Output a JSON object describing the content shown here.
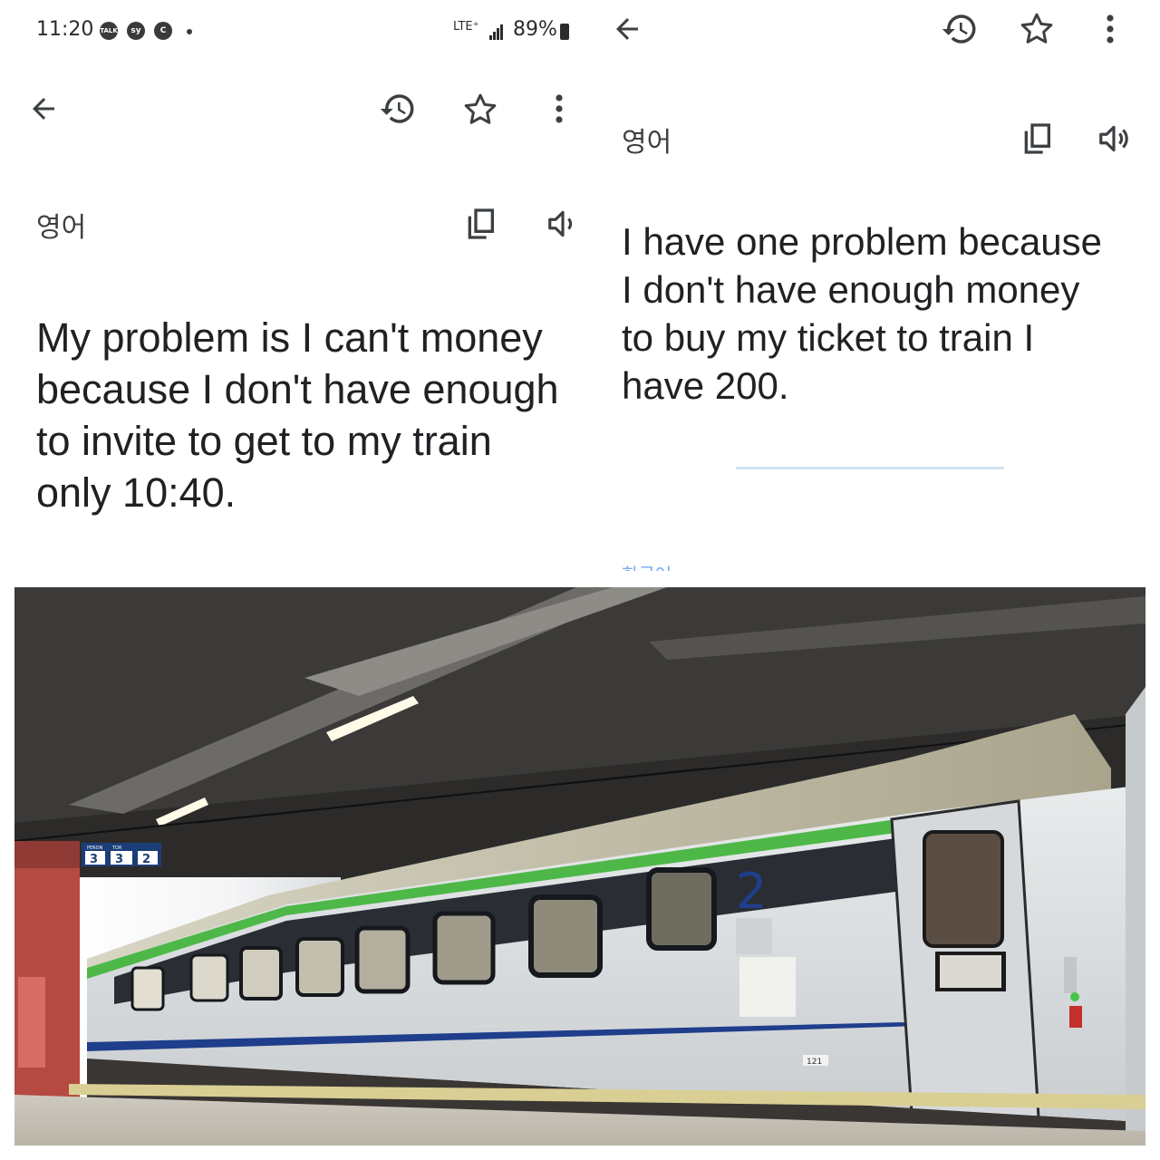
{
  "status_bar": {
    "time": "11:20",
    "badges": [
      "TALK",
      "sy",
      "C"
    ],
    "network": "LTE⁺",
    "battery": "89%"
  },
  "left_screen": {
    "language": "영어",
    "text_lines": [
      "My problem is I can't money",
      "because I don't have enough",
      "to invite to get to my train",
      "only 10:40."
    ],
    "icons": [
      "back-arrow-icon",
      "history-icon",
      "star-icon",
      "more-vert-icon",
      "copy-icon",
      "speaker-icon"
    ]
  },
  "right_screen": {
    "language": "영어",
    "text_lines": [
      "I have one problem because",
      "I don't have enough money",
      "to buy my ticket to train I",
      "have 200."
    ],
    "partial_label": "한국어",
    "icons": [
      "back-arrow-icon",
      "history-icon",
      "star-icon",
      "more-vert-icon",
      "copy-icon",
      "speaker-icon"
    ]
  },
  "photo": {
    "platform_sign": [
      "PERON",
      "3",
      "TOR",
      "3",
      "",
      "2"
    ],
    "car_class_number": "2",
    "car_small_number": "121",
    "colors": {
      "platform_canopy": "#2c2b2a",
      "train_body": "#dcdfe2",
      "green_stripe": "#4db848",
      "blue_stripe": "#1f3e8c",
      "roof": "#b9b59f"
    }
  }
}
